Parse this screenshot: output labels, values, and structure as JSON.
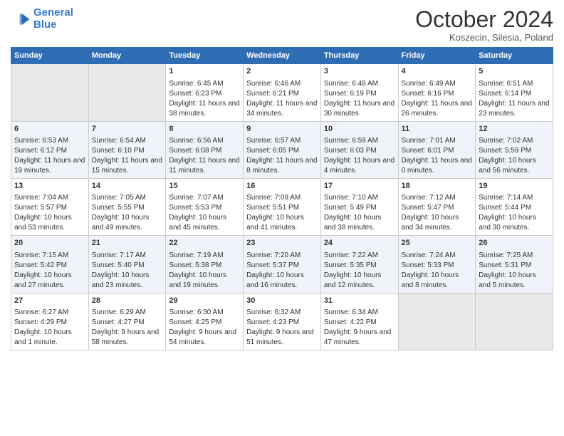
{
  "header": {
    "logo_line1": "General",
    "logo_line2": "Blue",
    "month": "October 2024",
    "location": "Koszecin, Silesia, Poland"
  },
  "weekdays": [
    "Sunday",
    "Monday",
    "Tuesday",
    "Wednesday",
    "Thursday",
    "Friday",
    "Saturday"
  ],
  "weeks": [
    [
      {
        "day": "",
        "sunrise": "",
        "sunset": "",
        "daylight": ""
      },
      {
        "day": "",
        "sunrise": "",
        "sunset": "",
        "daylight": ""
      },
      {
        "day": "1",
        "sunrise": "Sunrise: 6:45 AM",
        "sunset": "Sunset: 6:23 PM",
        "daylight": "Daylight: 11 hours and 38 minutes."
      },
      {
        "day": "2",
        "sunrise": "Sunrise: 6:46 AM",
        "sunset": "Sunset: 6:21 PM",
        "daylight": "Daylight: 11 hours and 34 minutes."
      },
      {
        "day": "3",
        "sunrise": "Sunrise: 6:48 AM",
        "sunset": "Sunset: 6:19 PM",
        "daylight": "Daylight: 11 hours and 30 minutes."
      },
      {
        "day": "4",
        "sunrise": "Sunrise: 6:49 AM",
        "sunset": "Sunset: 6:16 PM",
        "daylight": "Daylight: 11 hours and 26 minutes."
      },
      {
        "day": "5",
        "sunrise": "Sunrise: 6:51 AM",
        "sunset": "Sunset: 6:14 PM",
        "daylight": "Daylight: 11 hours and 23 minutes."
      }
    ],
    [
      {
        "day": "6",
        "sunrise": "Sunrise: 6:53 AM",
        "sunset": "Sunset: 6:12 PM",
        "daylight": "Daylight: 11 hours and 19 minutes."
      },
      {
        "day": "7",
        "sunrise": "Sunrise: 6:54 AM",
        "sunset": "Sunset: 6:10 PM",
        "daylight": "Daylight: 11 hours and 15 minutes."
      },
      {
        "day": "8",
        "sunrise": "Sunrise: 6:56 AM",
        "sunset": "Sunset: 6:08 PM",
        "daylight": "Daylight: 11 hours and 11 minutes."
      },
      {
        "day": "9",
        "sunrise": "Sunrise: 6:57 AM",
        "sunset": "Sunset: 6:05 PM",
        "daylight": "Daylight: 11 hours and 8 minutes."
      },
      {
        "day": "10",
        "sunrise": "Sunrise: 6:59 AM",
        "sunset": "Sunset: 6:03 PM",
        "daylight": "Daylight: 11 hours and 4 minutes."
      },
      {
        "day": "11",
        "sunrise": "Sunrise: 7:01 AM",
        "sunset": "Sunset: 6:01 PM",
        "daylight": "Daylight: 11 hours and 0 minutes."
      },
      {
        "day": "12",
        "sunrise": "Sunrise: 7:02 AM",
        "sunset": "Sunset: 5:59 PM",
        "daylight": "Daylight: 10 hours and 56 minutes."
      }
    ],
    [
      {
        "day": "13",
        "sunrise": "Sunrise: 7:04 AM",
        "sunset": "Sunset: 5:57 PM",
        "daylight": "Daylight: 10 hours and 53 minutes."
      },
      {
        "day": "14",
        "sunrise": "Sunrise: 7:05 AM",
        "sunset": "Sunset: 5:55 PM",
        "daylight": "Daylight: 10 hours and 49 minutes."
      },
      {
        "day": "15",
        "sunrise": "Sunrise: 7:07 AM",
        "sunset": "Sunset: 5:53 PM",
        "daylight": "Daylight: 10 hours and 45 minutes."
      },
      {
        "day": "16",
        "sunrise": "Sunrise: 7:09 AM",
        "sunset": "Sunset: 5:51 PM",
        "daylight": "Daylight: 10 hours and 41 minutes."
      },
      {
        "day": "17",
        "sunrise": "Sunrise: 7:10 AM",
        "sunset": "Sunset: 5:49 PM",
        "daylight": "Daylight: 10 hours and 38 minutes."
      },
      {
        "day": "18",
        "sunrise": "Sunrise: 7:12 AM",
        "sunset": "Sunset: 5:47 PM",
        "daylight": "Daylight: 10 hours and 34 minutes."
      },
      {
        "day": "19",
        "sunrise": "Sunrise: 7:14 AM",
        "sunset": "Sunset: 5:44 PM",
        "daylight": "Daylight: 10 hours and 30 minutes."
      }
    ],
    [
      {
        "day": "20",
        "sunrise": "Sunrise: 7:15 AM",
        "sunset": "Sunset: 5:42 PM",
        "daylight": "Daylight: 10 hours and 27 minutes."
      },
      {
        "day": "21",
        "sunrise": "Sunrise: 7:17 AM",
        "sunset": "Sunset: 5:40 PM",
        "daylight": "Daylight: 10 hours and 23 minutes."
      },
      {
        "day": "22",
        "sunrise": "Sunrise: 7:19 AM",
        "sunset": "Sunset: 5:38 PM",
        "daylight": "Daylight: 10 hours and 19 minutes."
      },
      {
        "day": "23",
        "sunrise": "Sunrise: 7:20 AM",
        "sunset": "Sunset: 5:37 PM",
        "daylight": "Daylight: 10 hours and 16 minutes."
      },
      {
        "day": "24",
        "sunrise": "Sunrise: 7:22 AM",
        "sunset": "Sunset: 5:35 PM",
        "daylight": "Daylight: 10 hours and 12 minutes."
      },
      {
        "day": "25",
        "sunrise": "Sunrise: 7:24 AM",
        "sunset": "Sunset: 5:33 PM",
        "daylight": "Daylight: 10 hours and 8 minutes."
      },
      {
        "day": "26",
        "sunrise": "Sunrise: 7:25 AM",
        "sunset": "Sunset: 5:31 PM",
        "daylight": "Daylight: 10 hours and 5 minutes."
      }
    ],
    [
      {
        "day": "27",
        "sunrise": "Sunrise: 6:27 AM",
        "sunset": "Sunset: 4:29 PM",
        "daylight": "Daylight: 10 hours and 1 minute."
      },
      {
        "day": "28",
        "sunrise": "Sunrise: 6:29 AM",
        "sunset": "Sunset: 4:27 PM",
        "daylight": "Daylight: 9 hours and 58 minutes."
      },
      {
        "day": "29",
        "sunrise": "Sunrise: 6:30 AM",
        "sunset": "Sunset: 4:25 PM",
        "daylight": "Daylight: 9 hours and 54 minutes."
      },
      {
        "day": "30",
        "sunrise": "Sunrise: 6:32 AM",
        "sunset": "Sunset: 4:23 PM",
        "daylight": "Daylight: 9 hours and 51 minutes."
      },
      {
        "day": "31",
        "sunrise": "Sunrise: 6:34 AM",
        "sunset": "Sunset: 4:22 PM",
        "daylight": "Daylight: 9 hours and 47 minutes."
      },
      {
        "day": "",
        "sunrise": "",
        "sunset": "",
        "daylight": ""
      },
      {
        "day": "",
        "sunrise": "",
        "sunset": "",
        "daylight": ""
      }
    ]
  ]
}
